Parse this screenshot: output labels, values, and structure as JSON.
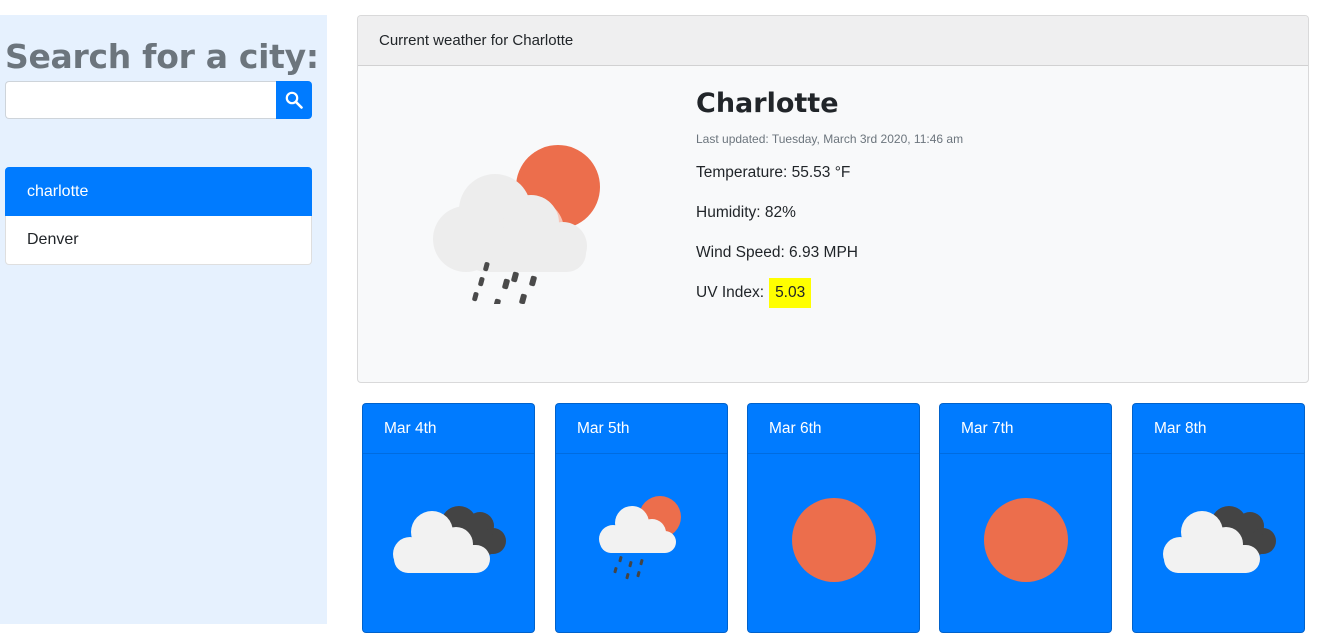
{
  "sidebar": {
    "title": "Search for a city:",
    "search": {
      "value": "",
      "placeholder": "",
      "button_icon": "search-icon"
    },
    "cities": [
      {
        "label": "charlotte",
        "active": true
      },
      {
        "label": "Denver",
        "active": false
      }
    ]
  },
  "current": {
    "header": "Current weather for Charlotte",
    "city": "Charlotte",
    "updated": "Last updated: Tuesday, March 3rd 2020, 11:46 am",
    "temperature": "Temperature: 55.53 °F",
    "humidity": "Humidity: 82%",
    "wind": "Wind Speed: 6.93 MPH",
    "uv_label": "UV Index:",
    "uv_value": "5.03",
    "icon": "cloud-sun-rain-icon"
  },
  "forecast": [
    {
      "date": "Mar 4th",
      "icon": "cloudy-icon"
    },
    {
      "date": "Mar 5th",
      "icon": "cloud-sun-rain-icon"
    },
    {
      "date": "Mar 6th",
      "icon": "sun-icon"
    },
    {
      "date": "Mar 7th",
      "icon": "sun-icon"
    },
    {
      "date": "Mar 8th",
      "icon": "cloudy-icon"
    }
  ],
  "colors": {
    "primary": "#007bff",
    "sidebar_bg": "#e6f1fe",
    "sun": "#ec6e4c",
    "uv_highlight": "#ffff00"
  }
}
